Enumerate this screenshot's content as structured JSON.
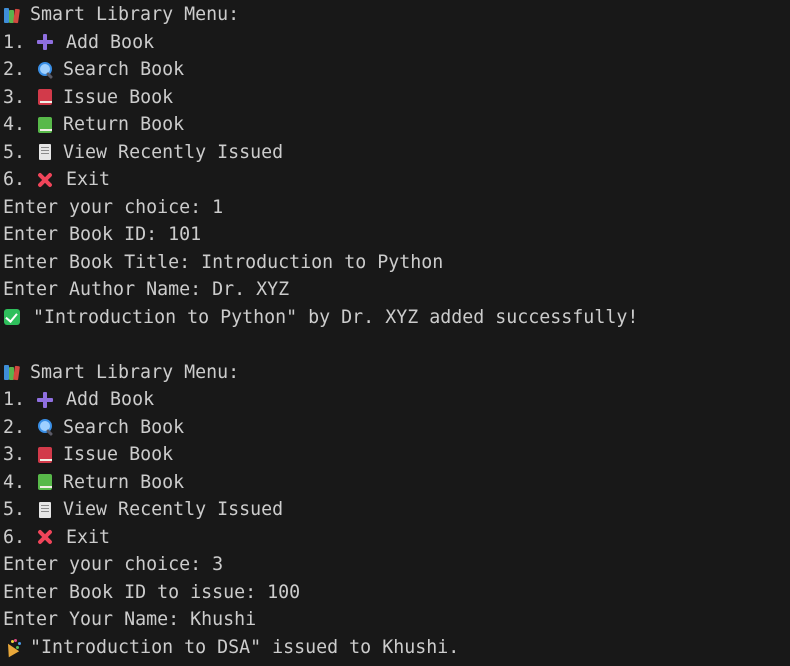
{
  "icons": {
    "books": "books-icon",
    "add": "plus-icon",
    "search": "magnifier-icon",
    "issue": "red-book-icon",
    "return": "green-book-icon",
    "view": "receipt-icon",
    "exit": "cross-mark-icon",
    "success": "check-mark-icon",
    "celebrate": "party-popper-icon"
  },
  "session1": {
    "menu_title": "Smart Library Menu:",
    "items": [
      {
        "num": "1.",
        "label": "Add Book"
      },
      {
        "num": "2.",
        "label": "Search Book"
      },
      {
        "num": "3.",
        "label": "Issue Book"
      },
      {
        "num": "4.",
        "label": "Return Book"
      },
      {
        "num": "5.",
        "label": "View Recently Issued"
      },
      {
        "num": "6.",
        "label": "Exit"
      }
    ],
    "prompts": [
      "Enter your choice: 1",
      "Enter Book ID: 101",
      "Enter Book Title: Introduction to Python",
      "Enter Author Name: Dr. XYZ"
    ],
    "result": "\"Introduction to Python\" by Dr. XYZ added successfully!"
  },
  "session2": {
    "menu_title": "Smart Library Menu:",
    "items": [
      {
        "num": "1.",
        "label": "Add Book"
      },
      {
        "num": "2.",
        "label": "Search Book"
      },
      {
        "num": "3.",
        "label": "Issue Book"
      },
      {
        "num": "4.",
        "label": "Return Book"
      },
      {
        "num": "5.",
        "label": "View Recently Issued"
      },
      {
        "num": "6.",
        "label": "Exit"
      }
    ],
    "prompts": [
      "Enter your choice: 3",
      "Enter Book ID to issue: 100",
      "Enter Your Name: Khushi"
    ],
    "result": "\"Introduction to DSA\" issued to Khushi."
  },
  "colors": {
    "background": "#181818",
    "text": "#cccccc"
  }
}
